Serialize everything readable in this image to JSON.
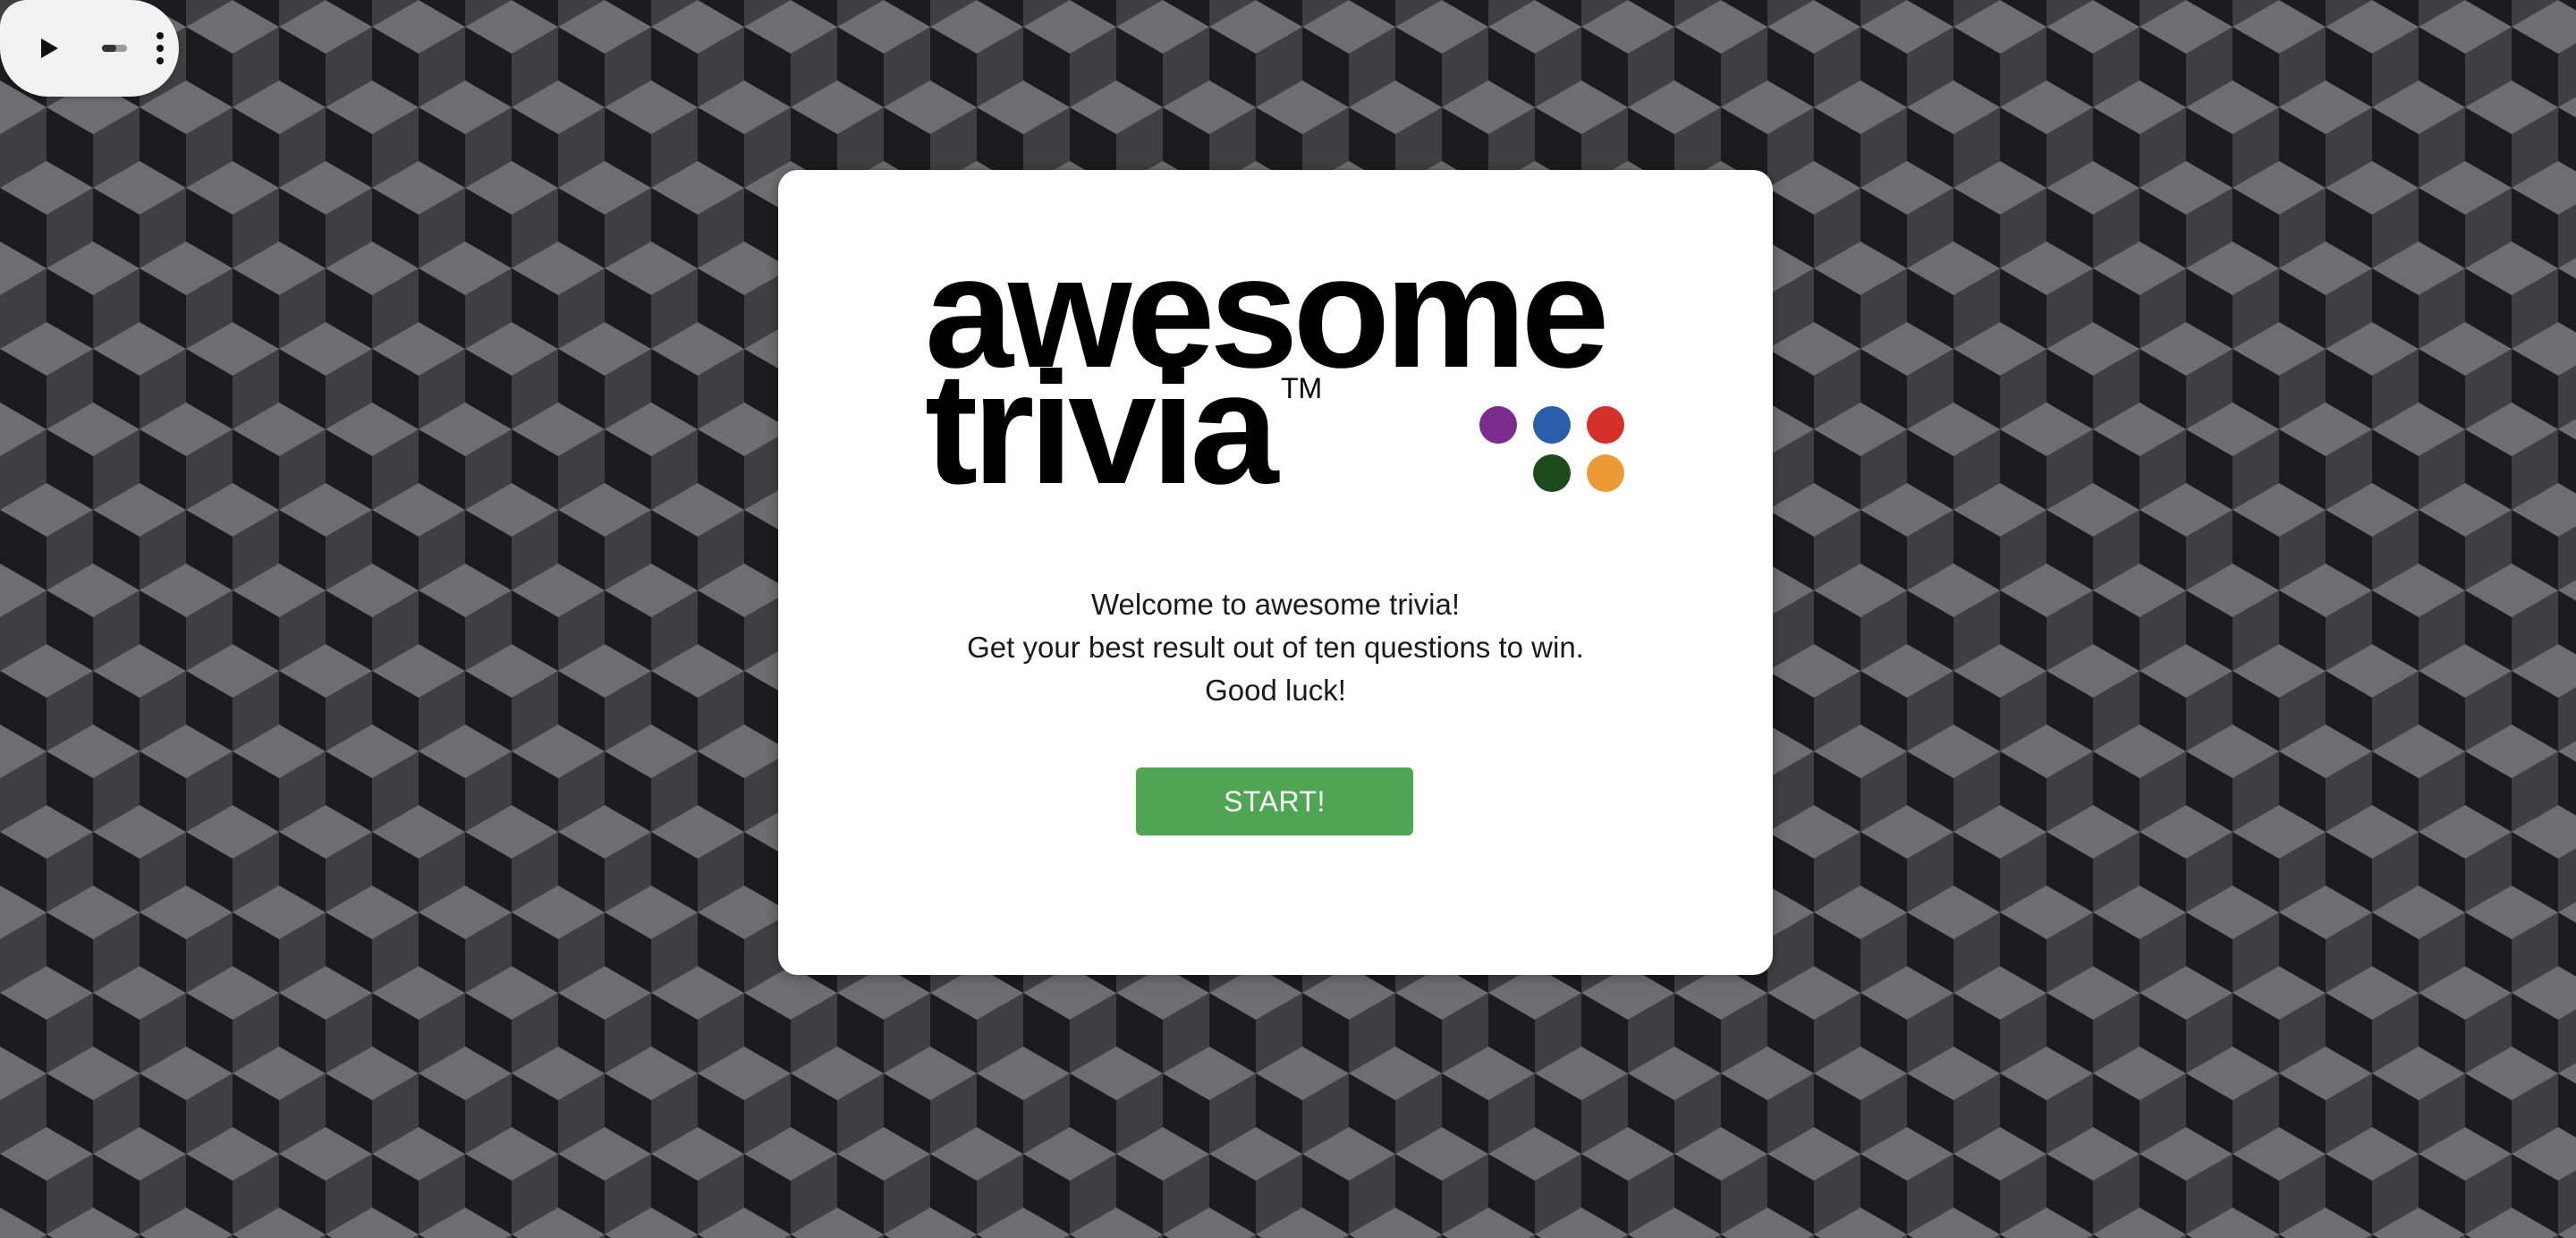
{
  "media_controls": {
    "play_icon": "play-icon",
    "toggle_icon": "toggle-icon",
    "more_icon": "more-vert-icon"
  },
  "logo": {
    "line1": "awesome",
    "line2": "trivia",
    "trademark": "TM",
    "dots": [
      {
        "color": "#7b2d8e"
      },
      {
        "color": "#2a5ea8"
      },
      {
        "color": "#d4302a"
      },
      {
        "color": "#1e4a1e"
      },
      {
        "color": "#eb9a36"
      }
    ]
  },
  "welcome": {
    "line1": "Welcome to awesome trivia!",
    "line2": "Get your best result out of ten questions to win.",
    "line3": "Good luck!"
  },
  "start_button": {
    "label": "START!"
  },
  "colors": {
    "background_pattern": [
      "#1c1c1e",
      "#404042",
      "#6e6e70"
    ],
    "card": "#ffffff",
    "start_button": "#4fa553"
  }
}
